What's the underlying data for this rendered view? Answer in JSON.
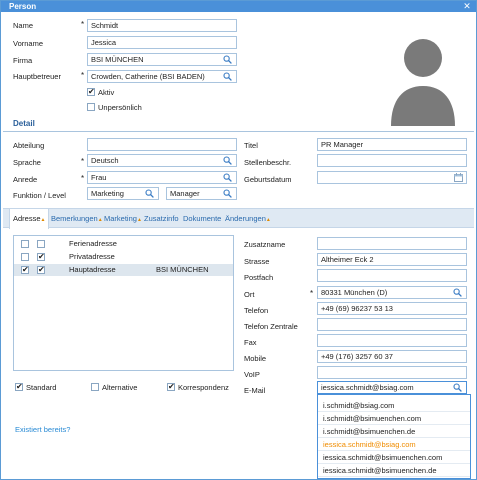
{
  "window": {
    "title": "Person"
  },
  "person": {
    "name_label": "Name",
    "name_value": "Schmidt",
    "vorname_label": "Vorname",
    "vorname_value": "Jessica",
    "firma_label": "Firma",
    "firma_value": "BSI MÜNCHEN",
    "hauptbetreuer_label": "Hauptbetreuer",
    "hauptbetreuer_value": "Crowden, Catherine (BSI BADEN)",
    "aktiv_label": "Aktiv",
    "unpersoenlich_label": "Unpersönlich",
    "required_mark": "*"
  },
  "detail": {
    "section_title": "Detail",
    "abteilung_label": "Abteilung",
    "abteilung_value": "",
    "sprache_label": "Sprache",
    "sprache_value": "Deutsch",
    "anrede_label": "Anrede",
    "anrede_value": "Frau",
    "funktion_label": "Funktion / Level",
    "funktion_value": "Marketing",
    "level_value": "Manager",
    "titel_label": "Titel",
    "titel_value": "PR Manager",
    "stellen_label": "Stellenbeschr.",
    "stellen_value": "",
    "geburtsdatum_label": "Geburtsdatum",
    "geburtsdatum_value": ""
  },
  "tabs": [
    {
      "label": "Adresse",
      "arrow": "▲"
    },
    {
      "label": "Bemerkungen",
      "arrow": "▲"
    },
    {
      "label": "Marketing",
      "arrow": "▲"
    },
    {
      "label": "Zusatzinfo",
      "arrow": ""
    },
    {
      "label": "Dokumente",
      "arrow": ""
    },
    {
      "label": "Änderungen",
      "arrow": "▲"
    }
  ],
  "addresses": [
    {
      "c1": "",
      "c2": "",
      "type": "Ferienadresse",
      "firm": ""
    },
    {
      "c1": "",
      "c2": "✔",
      "type": "Privatadresse",
      "firm": ""
    },
    {
      "c1": "✔",
      "c2": "✔",
      "type": "Hauptadresse",
      "firm": "BSI MÜNCHEN"
    }
  ],
  "address_flags": {
    "standard_label": "Standard",
    "alternative_label": "Alternative",
    "korrespondenz_label": "Korrespondenz"
  },
  "address_detail": {
    "zusatzname_label": "Zusatzname",
    "zusatzname_value": "",
    "strasse_label": "Strasse",
    "strasse_value": "Altheimer Eck 2",
    "postfach_label": "Postfach",
    "postfach_value": "",
    "ort_label": "Ort",
    "ort_value": "80331 München (D)",
    "telefon_label": "Telefon",
    "telefon_value": "+49 (69) 96237 53 13",
    "telefon_zentrale_label": "Telefon Zentrale",
    "telefon_zentrale_value": "",
    "fax_label": "Fax",
    "fax_value": "",
    "mobile_label": "Mobile",
    "mobile_value": "+49 (176) 3257 60 37",
    "voip_label": "VoIP",
    "voip_value": "",
    "email_label": "E-Mail",
    "email_value": "iessica.schmidt@bsiag.com"
  },
  "email_suggestions": [
    "i.schmidt@bsiag.com",
    "i.schmidt@bsimuenchen.com",
    "i.schmidt@bsimuenchen.de",
    "iessica.schmidt@bsiag.com",
    "iessica.schmidt@bsimuenchen.com",
    "iessica.schmidt@bsimuenchen.de"
  ],
  "footer": {
    "existiert_link": "Existiert bereits?"
  },
  "colors": {
    "titlebar": "#4a90d9",
    "link": "#2a8bd5",
    "highlight": "#f08c00",
    "field_border": "#a9c4de"
  }
}
